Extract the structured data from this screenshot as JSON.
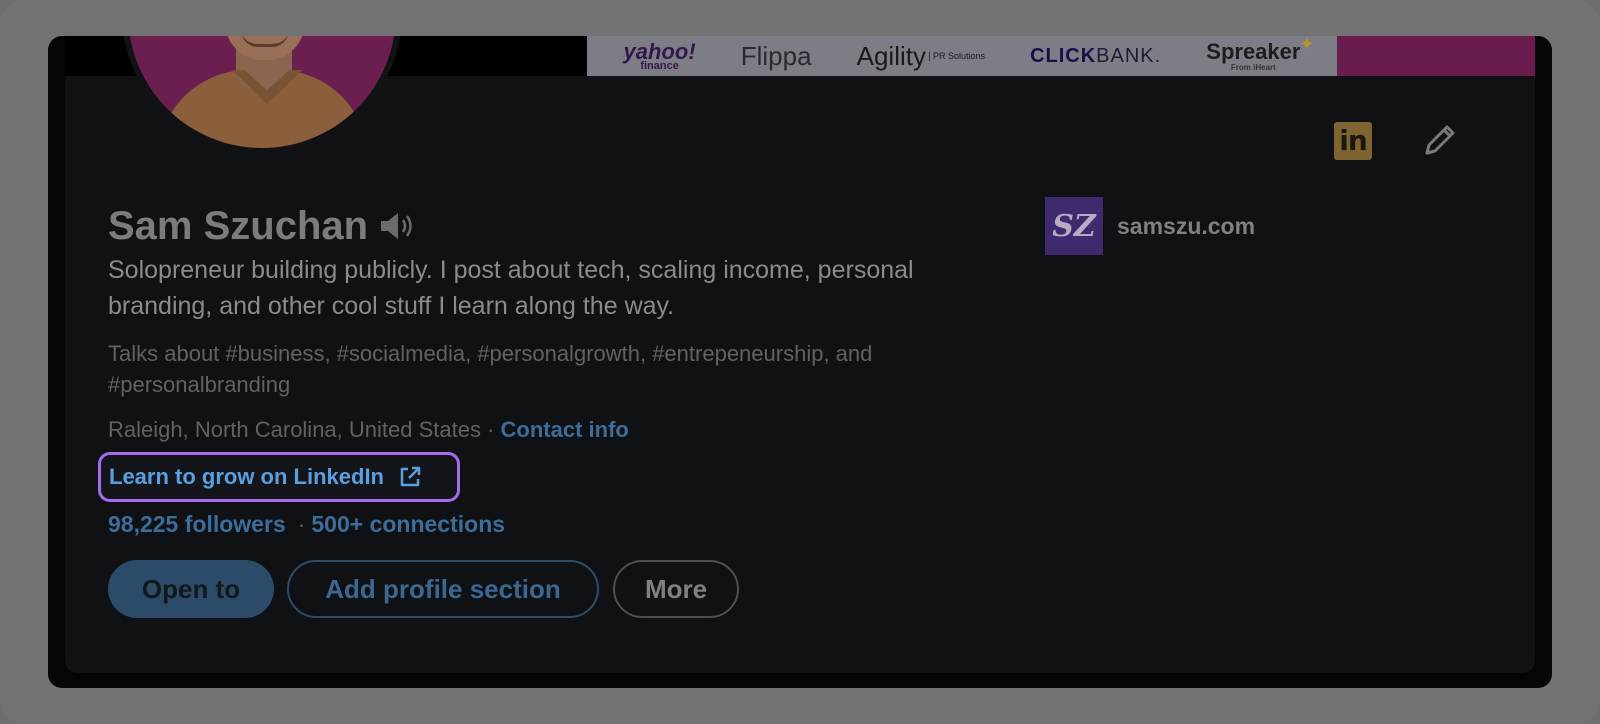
{
  "banner": {
    "logos": {
      "yahoo": "yahoo!",
      "yahoo_sub": "finance",
      "flippa": "Flippa",
      "agility": "Agility",
      "agility_sub": "PR Solutions",
      "clickbank_a": "CLICK",
      "clickbank_b": "BANK.",
      "spreaker": "Spreaker",
      "spreaker_sub": "From iHeart"
    }
  },
  "profile": {
    "name": "Sam Szuchan",
    "headline": "Solopreneur building publicly. I post about tech, scaling income, personal branding, and other cool stuff I learn along the way.",
    "talks_about": "Talks about #business, #socialmedia, #personalgrowth, #entrepeneurship, and #personalbranding",
    "location": "Raleigh, North Carolina, United States",
    "location_separator": " · ",
    "contact_info": "Contact info",
    "learn_link": "Learn to grow on LinkedIn",
    "followers": "98,225 followers",
    "stats_separator": "·",
    "connections": "500+ connections"
  },
  "actions": {
    "open_to": "Open to",
    "add_section": "Add profile section",
    "more": "More"
  },
  "company": {
    "logo_text": "SZ",
    "name": "samszu.com"
  },
  "icons": {
    "linkedin": "linkedin-icon",
    "pencil": "pencil-icon",
    "speaker": "speaker-icon",
    "external": "external-link-icon"
  },
  "colors": {
    "highlight_border": "#a76bf0",
    "link_blue": "#5a9fe0",
    "muted_link": "#3d6d9a",
    "brand_logo_bg": "#3f2a6e"
  }
}
